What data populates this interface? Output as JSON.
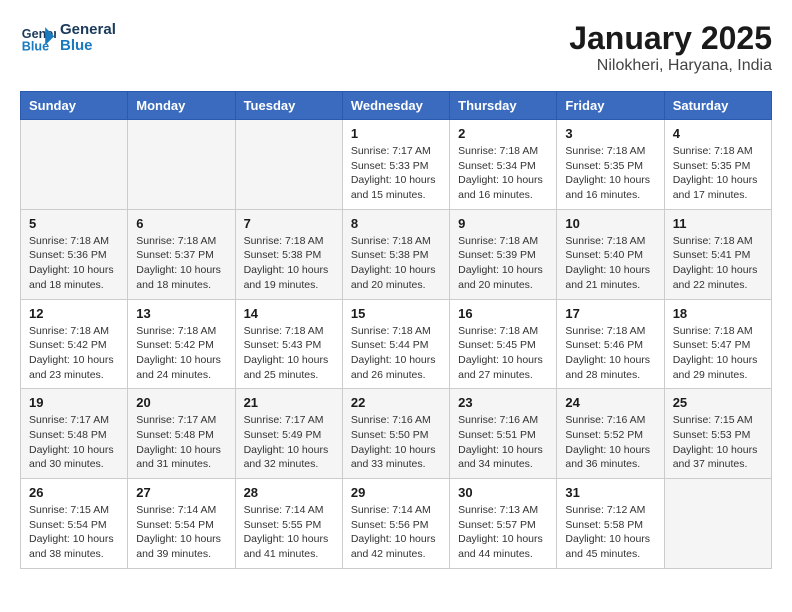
{
  "header": {
    "logo_line1": "General",
    "logo_line2": "Blue",
    "title": "January 2025",
    "subtitle": "Nilokheri, Haryana, India"
  },
  "weekdays": [
    "Sunday",
    "Monday",
    "Tuesday",
    "Wednesday",
    "Thursday",
    "Friday",
    "Saturday"
  ],
  "weeks": [
    [
      {
        "day": "",
        "info": ""
      },
      {
        "day": "",
        "info": ""
      },
      {
        "day": "",
        "info": ""
      },
      {
        "day": "1",
        "info": "Sunrise: 7:17 AM\nSunset: 5:33 PM\nDaylight: 10 hours\nand 15 minutes."
      },
      {
        "day": "2",
        "info": "Sunrise: 7:18 AM\nSunset: 5:34 PM\nDaylight: 10 hours\nand 16 minutes."
      },
      {
        "day": "3",
        "info": "Sunrise: 7:18 AM\nSunset: 5:35 PM\nDaylight: 10 hours\nand 16 minutes."
      },
      {
        "day": "4",
        "info": "Sunrise: 7:18 AM\nSunset: 5:35 PM\nDaylight: 10 hours\nand 17 minutes."
      }
    ],
    [
      {
        "day": "5",
        "info": "Sunrise: 7:18 AM\nSunset: 5:36 PM\nDaylight: 10 hours\nand 18 minutes."
      },
      {
        "day": "6",
        "info": "Sunrise: 7:18 AM\nSunset: 5:37 PM\nDaylight: 10 hours\nand 18 minutes."
      },
      {
        "day": "7",
        "info": "Sunrise: 7:18 AM\nSunset: 5:38 PM\nDaylight: 10 hours\nand 19 minutes."
      },
      {
        "day": "8",
        "info": "Sunrise: 7:18 AM\nSunset: 5:38 PM\nDaylight: 10 hours\nand 20 minutes."
      },
      {
        "day": "9",
        "info": "Sunrise: 7:18 AM\nSunset: 5:39 PM\nDaylight: 10 hours\nand 20 minutes."
      },
      {
        "day": "10",
        "info": "Sunrise: 7:18 AM\nSunset: 5:40 PM\nDaylight: 10 hours\nand 21 minutes."
      },
      {
        "day": "11",
        "info": "Sunrise: 7:18 AM\nSunset: 5:41 PM\nDaylight: 10 hours\nand 22 minutes."
      }
    ],
    [
      {
        "day": "12",
        "info": "Sunrise: 7:18 AM\nSunset: 5:42 PM\nDaylight: 10 hours\nand 23 minutes."
      },
      {
        "day": "13",
        "info": "Sunrise: 7:18 AM\nSunset: 5:42 PM\nDaylight: 10 hours\nand 24 minutes."
      },
      {
        "day": "14",
        "info": "Sunrise: 7:18 AM\nSunset: 5:43 PM\nDaylight: 10 hours\nand 25 minutes."
      },
      {
        "day": "15",
        "info": "Sunrise: 7:18 AM\nSunset: 5:44 PM\nDaylight: 10 hours\nand 26 minutes."
      },
      {
        "day": "16",
        "info": "Sunrise: 7:18 AM\nSunset: 5:45 PM\nDaylight: 10 hours\nand 27 minutes."
      },
      {
        "day": "17",
        "info": "Sunrise: 7:18 AM\nSunset: 5:46 PM\nDaylight: 10 hours\nand 28 minutes."
      },
      {
        "day": "18",
        "info": "Sunrise: 7:18 AM\nSunset: 5:47 PM\nDaylight: 10 hours\nand 29 minutes."
      }
    ],
    [
      {
        "day": "19",
        "info": "Sunrise: 7:17 AM\nSunset: 5:48 PM\nDaylight: 10 hours\nand 30 minutes."
      },
      {
        "day": "20",
        "info": "Sunrise: 7:17 AM\nSunset: 5:48 PM\nDaylight: 10 hours\nand 31 minutes."
      },
      {
        "day": "21",
        "info": "Sunrise: 7:17 AM\nSunset: 5:49 PM\nDaylight: 10 hours\nand 32 minutes."
      },
      {
        "day": "22",
        "info": "Sunrise: 7:16 AM\nSunset: 5:50 PM\nDaylight: 10 hours\nand 33 minutes."
      },
      {
        "day": "23",
        "info": "Sunrise: 7:16 AM\nSunset: 5:51 PM\nDaylight: 10 hours\nand 34 minutes."
      },
      {
        "day": "24",
        "info": "Sunrise: 7:16 AM\nSunset: 5:52 PM\nDaylight: 10 hours\nand 36 minutes."
      },
      {
        "day": "25",
        "info": "Sunrise: 7:15 AM\nSunset: 5:53 PM\nDaylight: 10 hours\nand 37 minutes."
      }
    ],
    [
      {
        "day": "26",
        "info": "Sunrise: 7:15 AM\nSunset: 5:54 PM\nDaylight: 10 hours\nand 38 minutes."
      },
      {
        "day": "27",
        "info": "Sunrise: 7:14 AM\nSunset: 5:54 PM\nDaylight: 10 hours\nand 39 minutes."
      },
      {
        "day": "28",
        "info": "Sunrise: 7:14 AM\nSunset: 5:55 PM\nDaylight: 10 hours\nand 41 minutes."
      },
      {
        "day": "29",
        "info": "Sunrise: 7:14 AM\nSunset: 5:56 PM\nDaylight: 10 hours\nand 42 minutes."
      },
      {
        "day": "30",
        "info": "Sunrise: 7:13 AM\nSunset: 5:57 PM\nDaylight: 10 hours\nand 44 minutes."
      },
      {
        "day": "31",
        "info": "Sunrise: 7:12 AM\nSunset: 5:58 PM\nDaylight: 10 hours\nand 45 minutes."
      },
      {
        "day": "",
        "info": ""
      }
    ]
  ]
}
